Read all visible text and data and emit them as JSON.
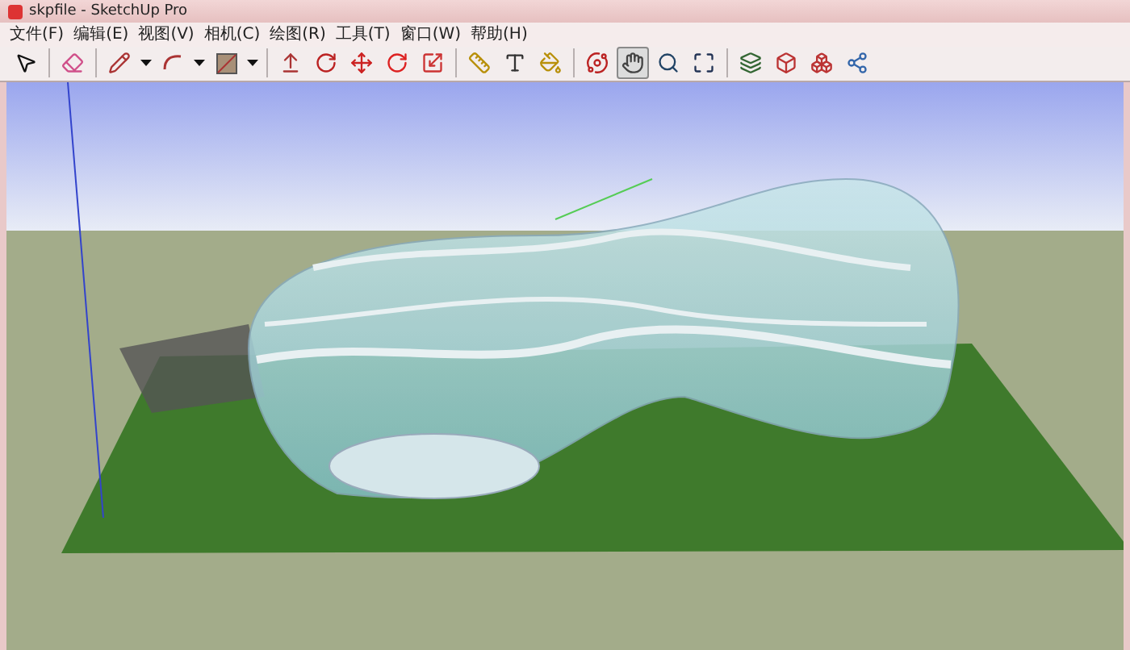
{
  "window": {
    "title": "skpfile - SketchUp Pro"
  },
  "menu": [
    "文件(F)",
    "编辑(E)",
    "视图(V)",
    "相机(C)",
    "绘图(R)",
    "工具(T)",
    "窗口(W)",
    "帮助(H)"
  ],
  "toolbar": [
    {
      "kind": "select",
      "selected": false
    },
    {
      "kind": "separator"
    },
    {
      "kind": "eraser",
      "selected": false
    },
    {
      "kind": "separator"
    },
    {
      "kind": "pencil",
      "selected": false
    },
    {
      "kind": "caret"
    },
    {
      "kind": "arc",
      "selected": false
    },
    {
      "kind": "caret"
    },
    {
      "kind": "rectangle",
      "selected": false
    },
    {
      "kind": "caret"
    },
    {
      "kind": "separator"
    },
    {
      "kind": "pushpull",
      "selected": false
    },
    {
      "kind": "followme",
      "selected": false
    },
    {
      "kind": "move",
      "selected": false
    },
    {
      "kind": "rotate",
      "selected": false
    },
    {
      "kind": "scale",
      "selected": false
    },
    {
      "kind": "separator"
    },
    {
      "kind": "tape",
      "selected": false
    },
    {
      "kind": "text",
      "selected": false
    },
    {
      "kind": "paint",
      "selected": false
    },
    {
      "kind": "separator"
    },
    {
      "kind": "orbit",
      "selected": false
    },
    {
      "kind": "pan",
      "selected": true
    },
    {
      "kind": "zoom",
      "selected": false
    },
    {
      "kind": "extents",
      "selected": false
    },
    {
      "kind": "separator"
    },
    {
      "kind": "scene",
      "selected": false
    },
    {
      "kind": "component",
      "selected": false
    },
    {
      "kind": "materials",
      "selected": false
    },
    {
      "kind": "share",
      "selected": false
    }
  ]
}
